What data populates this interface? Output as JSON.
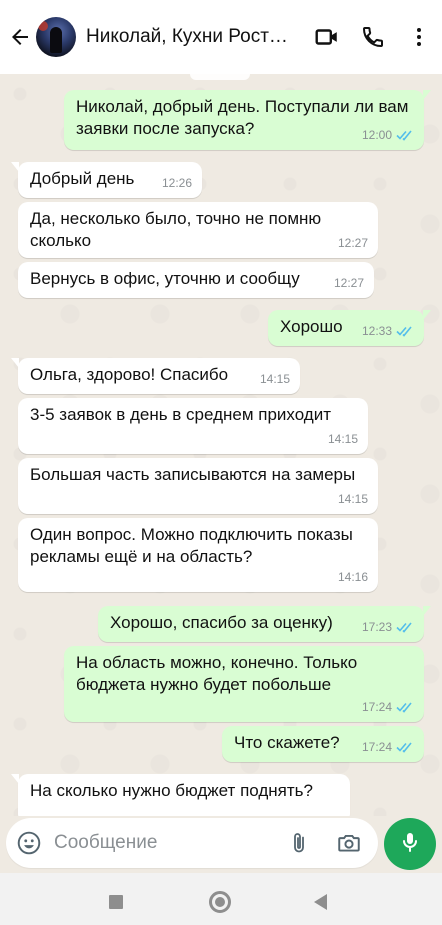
{
  "header": {
    "contact_name": "Николай, Кухни Рост…",
    "icons": [
      "back-arrow-icon",
      "video-call-icon",
      "phone-icon",
      "more-vert-icon"
    ]
  },
  "messages": [
    {
      "dir": "out",
      "text": "Николай, добрый день. Поступали ли вам заявки после запуска?",
      "time": "12:00",
      "read": true
    },
    {
      "dir": "in",
      "text": "Добрый день",
      "time": "12:26"
    },
    {
      "dir": "in",
      "text": "Да, несколько было, точно не помню сколько",
      "time": "12:27"
    },
    {
      "dir": "in",
      "text": "Вернусь в офис, уточню и сообщу",
      "time": "12:27"
    },
    {
      "dir": "out",
      "text": "Хорошо",
      "time": "12:33",
      "read": true
    },
    {
      "dir": "in",
      "text": "Ольга, здорово! Спасибо",
      "time": "14:15"
    },
    {
      "dir": "in",
      "text": "3-5 заявок в день в среднем приходит",
      "time": "14:15"
    },
    {
      "dir": "in",
      "text": "Большая часть записываются на замеры",
      "time": "14:15"
    },
    {
      "dir": "in",
      "text": "Один вопрос. Можно подключить показы рекламы ещё и на область?",
      "time": "14:16"
    },
    {
      "dir": "out",
      "text": "Хорошо, спасибо за оценку)",
      "time": "17:23",
      "read": true
    },
    {
      "dir": "out",
      "text": "На область можно, конечно. Только бюджета нужно будет побольше",
      "time": "17:24",
      "read": true
    },
    {
      "dir": "out",
      "text": "Что скажете?",
      "time": "17:24",
      "read": true
    },
    {
      "dir": "in",
      "text": "На сколько нужно бюджет поднять?",
      "time": ""
    }
  ],
  "composer": {
    "placeholder": "Сообщение",
    "icons": [
      "emoji-icon",
      "attach-icon",
      "camera-icon",
      "mic-icon"
    ]
  },
  "colors": {
    "outgoing_bubble": "#d9fdd3",
    "incoming_bubble": "#ffffff",
    "chat_background": "#efeae2",
    "read_ticks": "#53bdeb",
    "mic_button": "#1ea85a"
  }
}
